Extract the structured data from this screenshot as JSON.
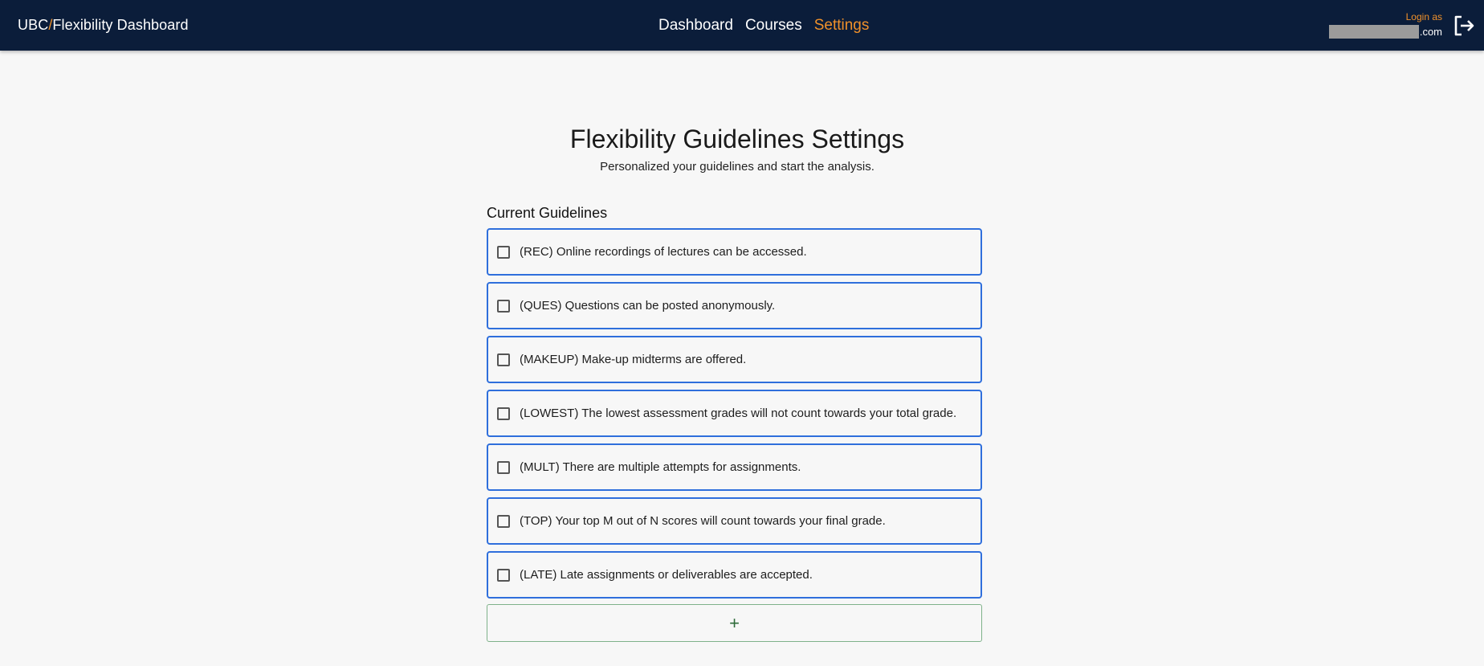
{
  "header": {
    "brand_prefix": "UBC",
    "brand_slash": "/",
    "brand_name": "Flexibility Dashboard",
    "nav": [
      {
        "label": "Dashboard"
      },
      {
        "label": "Courses"
      },
      {
        "label": "Settings",
        "active": true
      }
    ],
    "login_as_label": "Login as",
    "email_suffix": ".com",
    "logout_icon": "logout-icon"
  },
  "page": {
    "title": "Flexibility Guidelines Settings",
    "subtitle": "Personalized your guidelines and start the analysis.",
    "section_title": "Current Guidelines"
  },
  "guidelines": [
    {
      "label": "(REC) Online recordings of lectures can be accessed.",
      "checked": false
    },
    {
      "label": "(QUES) Questions can be posted anonymously.",
      "checked": false
    },
    {
      "label": "(MAKEUP) Make-up midterms are offered.",
      "checked": false
    },
    {
      "label": "(LOWEST) The lowest assessment grades will not count towards your total grade.",
      "checked": false
    },
    {
      "label": "(MULT) There are multiple attempts for assignments.",
      "checked": false
    },
    {
      "label": "(TOP) Your top M out of N scores will count towards your final grade.",
      "checked": false
    },
    {
      "label": "(LATE) Late assignments or deliverables are accepted.",
      "checked": false
    }
  ],
  "add_button": {
    "label": "+",
    "icon": "plus-icon"
  },
  "colors": {
    "header_bg": "#0b1d3a",
    "accent": "#f0912a",
    "item_border": "#2f6fdc",
    "add_border": "#7fb28a"
  }
}
